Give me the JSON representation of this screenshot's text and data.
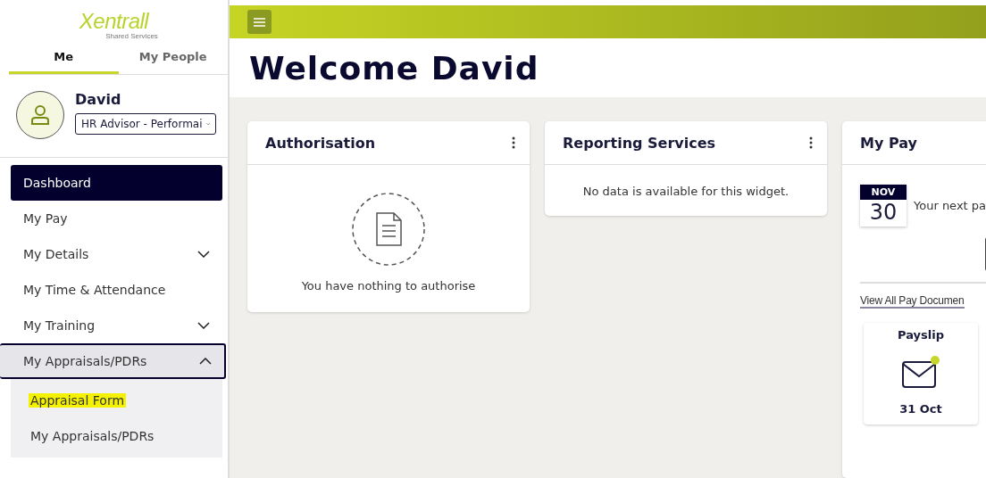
{
  "logo": {
    "name": "Xentrall",
    "tagline": "Shared Services"
  },
  "tabs": [
    {
      "label": "Me",
      "selected": true
    },
    {
      "label": "My People",
      "selected": false
    }
  ],
  "profile": {
    "name": "David",
    "role": "HR Advisor - Performai"
  },
  "nav": [
    {
      "label": "Dashboard",
      "kind": "link",
      "selected": true
    },
    {
      "label": "My Pay",
      "kind": "link",
      "selected": false
    },
    {
      "label": "My Details",
      "kind": "group",
      "selected": false,
      "expanded": false
    },
    {
      "label": "My Time & Attendance",
      "kind": "link",
      "selected": false
    },
    {
      "label": "My Training",
      "kind": "group",
      "selected": false,
      "expanded": false
    },
    {
      "label": "My Appraisals/PDRs",
      "kind": "group",
      "selected": false,
      "expanded": true,
      "children": [
        {
          "label": "Appraisal Form",
          "selected": true
        },
        {
          "label": "My Appraisals/PDRs",
          "selected": false
        }
      ]
    }
  ],
  "page_title": "Welcome David",
  "widgets": [
    {
      "kind": "authorisation",
      "title": "Authorisation",
      "message": "You have nothing to authorise"
    },
    {
      "kind": "empty",
      "title": "Reporting Services",
      "message": "No data is available for this widget."
    },
    {
      "kind": "pay",
      "title": "My Pay",
      "month": "NOV",
      "day": "30",
      "next_pay": "Your next pa",
      "link": "View All Pay Documen",
      "doc_title": "Payslip",
      "doc_date": "31 Oct"
    }
  ]
}
